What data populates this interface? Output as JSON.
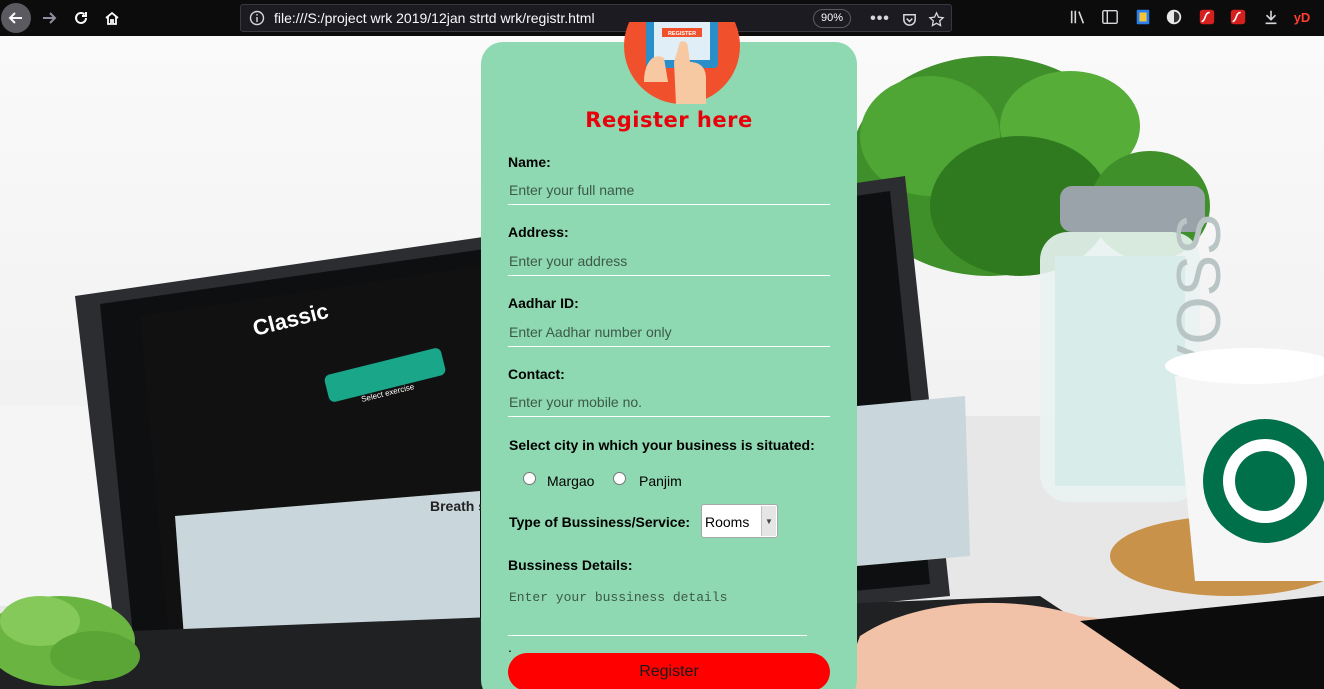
{
  "browser": {
    "url": "file:///S:/project wrk 2019/12jan strtd wrk/registr.html",
    "zoom": "90%",
    "toolbar_icons": [
      "back-arrow-icon",
      "forward-arrow-icon",
      "reload-icon",
      "home-icon",
      "info-icon",
      "ellipsis-icon",
      "pocket-icon",
      "star-icon",
      "library-icon",
      "sidebar-icon",
      "extension-icon",
      "shield-icon",
      "flash-icon",
      "flash-icon",
      "download-icon"
    ],
    "extension_label": "yD"
  },
  "form": {
    "title": "Register here",
    "logo_text": "REGISTER",
    "name": {
      "label": "Name:",
      "placeholder": "Enter your full name"
    },
    "address": {
      "label": "Address:",
      "placeholder": "Enter your address"
    },
    "aadhar": {
      "label": "Aadhar ID:",
      "placeholder": "Enter Aadhar number only"
    },
    "contact": {
      "label": "Contact:",
      "placeholder": "Enter your mobile no."
    },
    "city": {
      "label": "Select city in which your business is situated:",
      "options": [
        "Margao",
        "Panjim"
      ]
    },
    "business_type": {
      "label": "Type of Bussiness/Service:",
      "selected": "Rooms"
    },
    "details": {
      "label": "Bussiness Details:",
      "placeholder": "Enter your bussiness details",
      "note": "."
    },
    "submit_label": "Register"
  },
  "background_text": {
    "screen_title": "Classic",
    "screen_button": "Select exercise",
    "bottle_brand": "VOSS",
    "page_heading": "Breath study watc"
  },
  "colors": {
    "card_bg": "#8ed9b1",
    "title_red": "#e8000b",
    "button_red": "#ff0000",
    "toolbar_bg": "#0c0c0d"
  }
}
